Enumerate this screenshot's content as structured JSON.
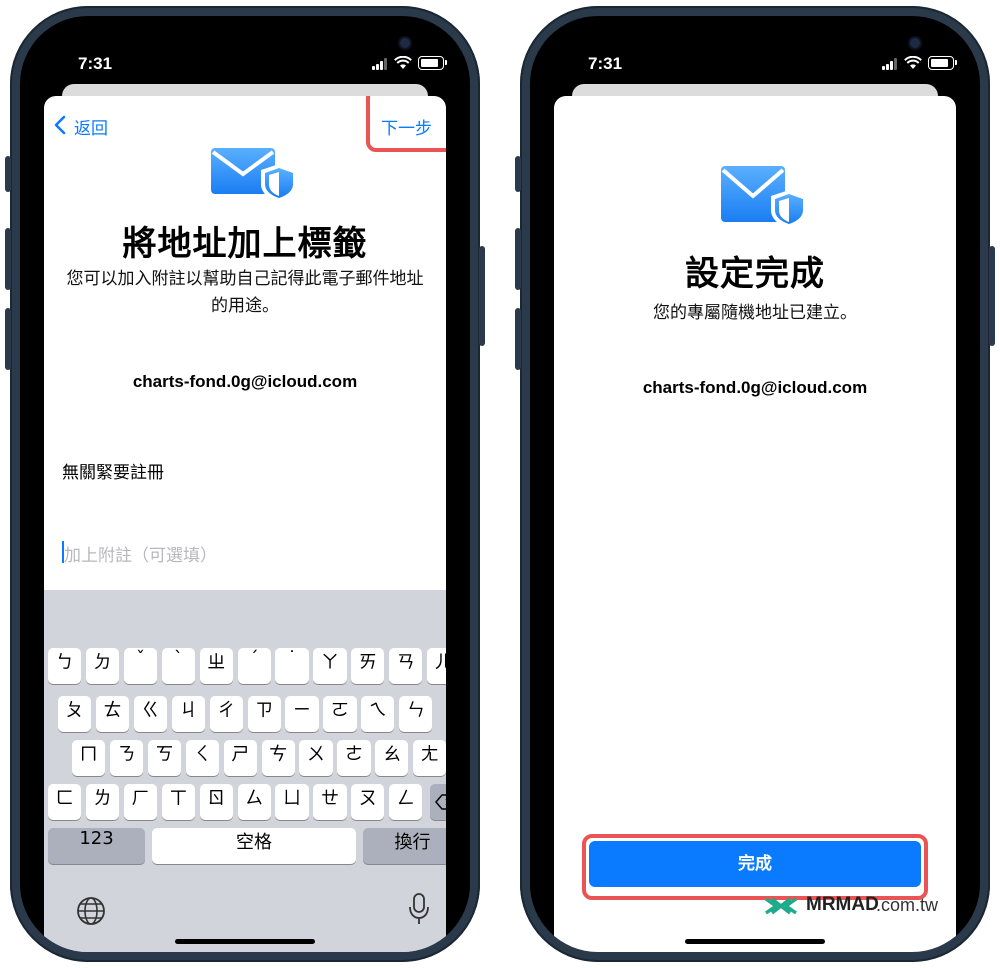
{
  "colors": {
    "accent": "#0a7aff",
    "highlight": "#ea5454",
    "frame": "#2a3a4a",
    "keyboard": "#d1d4db"
  },
  "left": {
    "time": "7:31",
    "back_label": "返回",
    "next_label": "下一步",
    "title": "將地址加上標籤",
    "description": "您可以加入附註以幫助自己記得此電子郵件地址的用途。",
    "email": "charts-fond.0g@icloud.com",
    "label_value": "無關緊要註冊",
    "note_placeholder": "加上附註（可選填）",
    "keyboard": {
      "row1": [
        "ㄅ",
        "ㄉ",
        "ˇ",
        "ˋ",
        "ㄓ",
        "ˊ",
        "˙",
        "ㄚ",
        "ㄞ",
        "ㄢ",
        "ㄦ"
      ],
      "row2": [
        "ㄆ",
        "ㄊ",
        "ㄍ",
        "ㄐ",
        "ㄔ",
        "ㄗ",
        "ㄧ",
        "ㄛ",
        "ㄟ",
        "ㄣ"
      ],
      "row3": [
        "ㄇ",
        "ㄋ",
        "ㄎ",
        "ㄑ",
        "ㄕ",
        "ㄘ",
        "ㄨ",
        "ㄜ",
        "ㄠ",
        "ㄤ"
      ],
      "row4": [
        "ㄈ",
        "ㄌ",
        "ㄏ",
        "ㄒ",
        "ㄖ",
        "ㄙ",
        "ㄩ",
        "ㄝ",
        "ㄡ",
        "ㄥ"
      ],
      "numbers_label": "123",
      "space_label": "空格",
      "return_label": "換行",
      "icons": [
        "globe-icon",
        "microphone-icon",
        "delete-icon"
      ]
    }
  },
  "right": {
    "time": "7:31",
    "title": "設定完成",
    "description": "您的專屬隨機地址已建立。",
    "email": "charts-fond.0g@icloud.com",
    "done_label": "完成"
  },
  "watermark": {
    "brand": "MRMAD",
    "domain": ".com.tw"
  }
}
